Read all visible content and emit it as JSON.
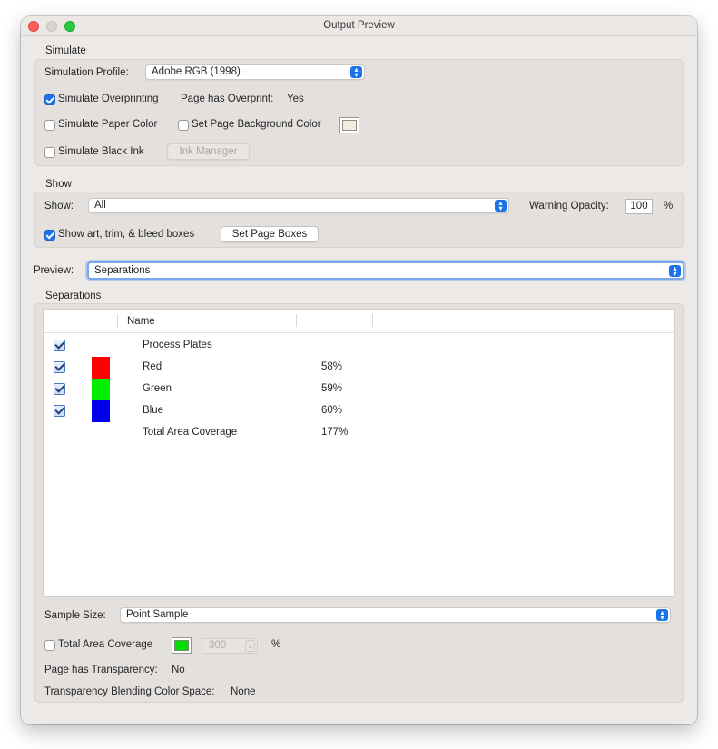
{
  "window": {
    "title": "Output Preview"
  },
  "simulate": {
    "heading": "Simulate",
    "profile_label": "Simulation Profile:",
    "profile_value": "Adobe RGB (1998)",
    "overprinting_label": "Simulate Overprinting",
    "overprinting_checked": true,
    "page_overprint_label": "Page has Overprint:",
    "page_overprint_value": "Yes",
    "paper_color_label": "Simulate Paper Color",
    "paper_color_checked": false,
    "bg_color_label": "Set Page Background Color",
    "bg_color_checked": false,
    "bg_swatch_color": "#efeedd",
    "black_ink_label": "Simulate Black Ink",
    "black_ink_checked": false,
    "ink_manager_label": "Ink Manager"
  },
  "show": {
    "heading": "Show",
    "show_label": "Show:",
    "show_value": "All",
    "warning_label": "Warning Opacity:",
    "warning_value": "100",
    "warning_unit": "%",
    "boxes_label": "Show art, trim, & bleed boxes",
    "boxes_checked": true,
    "page_boxes_button": "Set Page Boxes"
  },
  "preview": {
    "label": "Preview:",
    "value": "Separations"
  },
  "separations": {
    "heading": "Separations",
    "name_header": "Name",
    "rows": [
      {
        "name": "Process Plates",
        "value": "",
        "color": ""
      },
      {
        "name": "Red",
        "value": "58%",
        "color": "#ff0000"
      },
      {
        "name": "Green",
        "value": "59%",
        "color": "#00ee00"
      },
      {
        "name": "Blue",
        "value": "60%",
        "color": "#0000ee"
      },
      {
        "name": "Total Area Coverage",
        "value": "177%",
        "color": ""
      }
    ]
  },
  "sample": {
    "label": "Sample Size:",
    "value": "Point Sample"
  },
  "coverage": {
    "label": "Total Area Coverage",
    "checked": false,
    "swatch_color": "#00dd00",
    "value": "300",
    "unit": "%"
  },
  "transparency": {
    "label": "Page has Transparency:",
    "value": "No",
    "blend_label": "Transparency Blending Color Space:",
    "blend_value": "None"
  }
}
